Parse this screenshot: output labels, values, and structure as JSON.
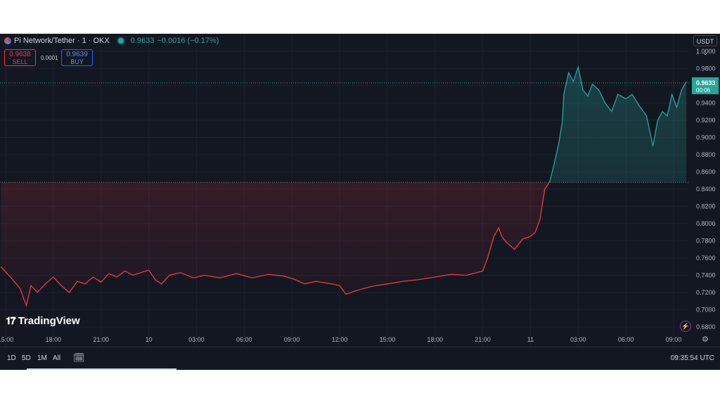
{
  "header": {
    "symbol_title": "Pi Network/Tether · 1 · OKX",
    "last_price": "0.9633",
    "change": "−0.0016 (−0.17%)"
  },
  "quote": {
    "sell_price": "0.9638",
    "sell_label": "SELL",
    "spread": "0.0001",
    "buy_price": "0.9639",
    "buy_label": "BUY"
  },
  "currency_selector": "USDT ⌄",
  "price_badge": {
    "price": "0.9633",
    "countdown": "00:06"
  },
  "bottom_toolbar": {
    "range_1d": "1D",
    "range_5d": "5D",
    "range_1m": "1M",
    "range_all": "All"
  },
  "clock": "09:35:54 UTC",
  "watermark": "TradingView",
  "colors": {
    "background": "#131722",
    "up": "#26a69a",
    "down": "#f23645",
    "grid": "#1f2330",
    "text": "#d1d4dc"
  },
  "chart_data": {
    "type": "area",
    "baseline": 0.848,
    "ylim": [
      0.68,
      1.0
    ],
    "yticks": [
      1.0,
      0.98,
      0.96,
      0.94,
      0.92,
      0.9,
      0.88,
      0.86,
      0.84,
      0.82,
      0.8,
      0.78,
      0.76,
      0.74,
      0.72,
      0.7,
      0.68
    ],
    "ytick_labels": [
      "1.0000",
      "0.9800",
      "0.9600",
      "0.9400",
      "0.9200",
      "0.9000",
      "0.8800",
      "0.8600",
      "0.8400",
      "0.8200",
      "0.8000",
      "0.7800",
      "0.7600",
      "0.7400",
      "0.7200",
      "0.7000",
      "0.6800"
    ],
    "xlim": [
      14.7,
      57.9
    ],
    "xticks": [
      15,
      18,
      21,
      24,
      27,
      30,
      33,
      36,
      39,
      42,
      45,
      48,
      51,
      54,
      57
    ],
    "xtick_labels": [
      "15:00",
      "18:00",
      "21:00",
      "10",
      "03:00",
      "06:00",
      "09:00",
      "12:00",
      "15:00",
      "18:00",
      "21:00",
      "11",
      "03:00",
      "06:00",
      "09:00"
    ],
    "x": [
      14.7,
      15.3,
      15.9,
      16.3,
      16.6,
      17.0,
      17.5,
      18.0,
      18.5,
      19.0,
      19.5,
      20.0,
      20.5,
      21.0,
      21.5,
      22.0,
      22.5,
      23.0,
      23.5,
      24.0,
      24.4,
      24.8,
      25.3,
      26.0,
      26.8,
      27.5,
      28.5,
      29.5,
      30.5,
      31.5,
      32.5,
      33.2,
      33.8,
      34.5,
      35.5,
      36.0,
      36.4,
      37.0,
      38.0,
      39.0,
      40.0,
      41.0,
      42.0,
      43.0,
      44.0,
      45.0,
      45.3,
      45.7,
      46.0,
      46.2,
      46.5,
      47.0,
      47.5,
      48.0,
      48.3,
      48.6,
      48.9,
      49.2,
      49.5,
      49.8,
      50.0,
      50.1,
      50.4,
      50.7,
      51.0,
      51.3,
      51.6,
      51.9,
      52.3,
      52.7,
      53.1,
      53.5,
      54.0,
      54.4,
      54.8,
      55.3,
      55.7,
      56.0,
      56.3,
      56.6,
      56.9,
      57.2,
      57.5,
      57.8
    ],
    "y": [
      0.75,
      0.738,
      0.725,
      0.705,
      0.728,
      0.72,
      0.73,
      0.738,
      0.728,
      0.72,
      0.733,
      0.73,
      0.738,
      0.732,
      0.742,
      0.738,
      0.745,
      0.74,
      0.743,
      0.746,
      0.735,
      0.73,
      0.74,
      0.743,
      0.737,
      0.74,
      0.737,
      0.742,
      0.737,
      0.741,
      0.739,
      0.735,
      0.73,
      0.733,
      0.73,
      0.728,
      0.718,
      0.722,
      0.727,
      0.73,
      0.733,
      0.735,
      0.738,
      0.741,
      0.74,
      0.745,
      0.76,
      0.785,
      0.795,
      0.785,
      0.778,
      0.77,
      0.782,
      0.785,
      0.79,
      0.805,
      0.84,
      0.848,
      0.87,
      0.895,
      0.918,
      0.95,
      0.975,
      0.965,
      0.982,
      0.955,
      0.948,
      0.962,
      0.955,
      0.94,
      0.93,
      0.95,
      0.945,
      0.95,
      0.938,
      0.925,
      0.89,
      0.92,
      0.93,
      0.925,
      0.95,
      0.935,
      0.955,
      0.965
    ]
  }
}
